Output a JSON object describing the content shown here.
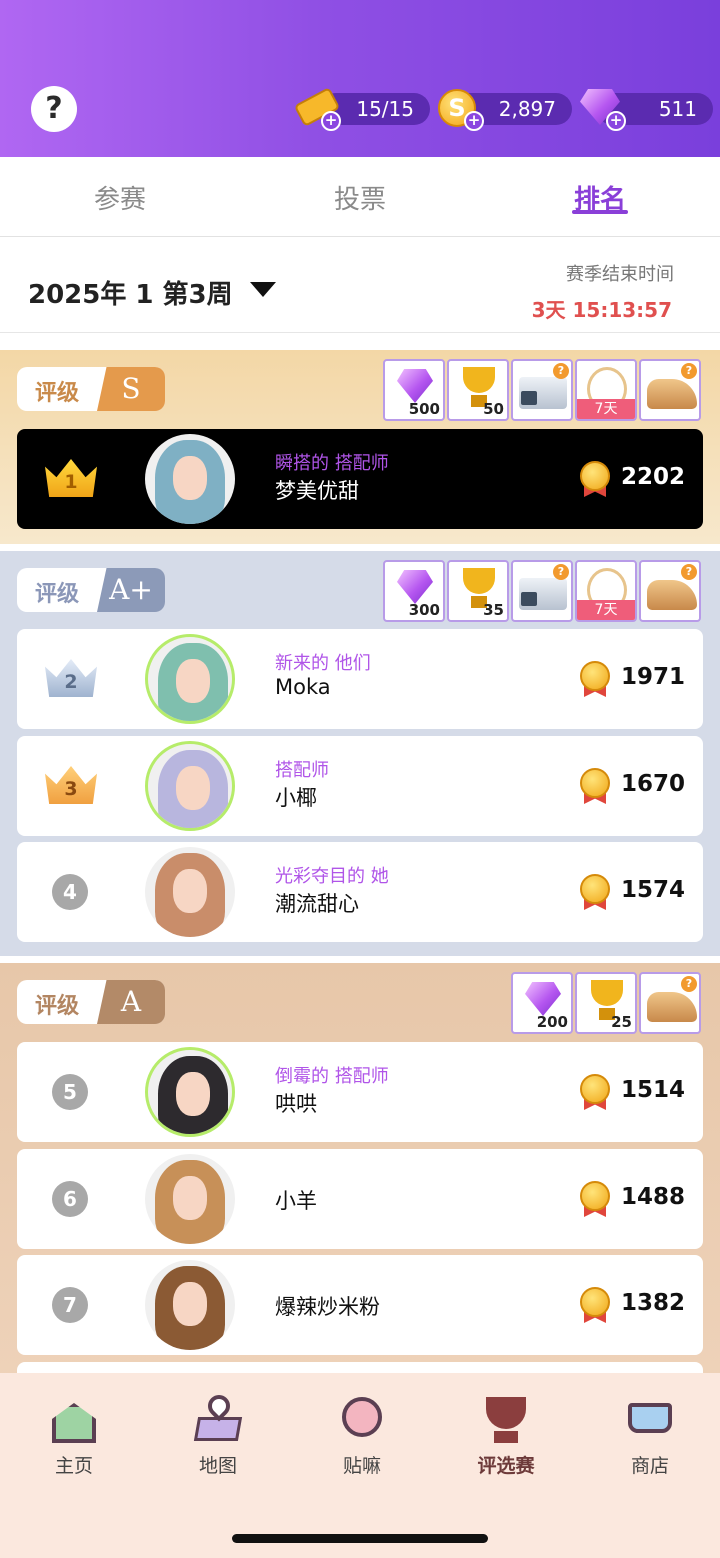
{
  "header": {
    "help_label": "?",
    "tickets": "15/15",
    "coins": "2,897",
    "gems": "511",
    "coin_symbol": "S",
    "plus": "+"
  },
  "tabs": [
    {
      "label": "参赛",
      "active": false
    },
    {
      "label": "投票",
      "active": false
    },
    {
      "label": "排名",
      "active": true
    }
  ],
  "week": {
    "label": "2025年 1 第3周",
    "season_end_label": "赛季结束时间",
    "countdown": "3天 15:13:57"
  },
  "tiers": [
    {
      "grade_label": "评级",
      "grade": "S",
      "rewards": [
        {
          "icon": "gem-icon",
          "amount": "500"
        },
        {
          "icon": "trophy-icon",
          "amount": "50"
        },
        {
          "icon": "makeup-set-icon",
          "amount": ""
        },
        {
          "icon": "necklace-icon",
          "amount": "",
          "tag": "7天"
        },
        {
          "icon": "shoe-icon",
          "amount": ""
        }
      ],
      "players": [
        {
          "rank": "1",
          "title": "瞬搭的 搭配师",
          "name": "梦美优甜",
          "score": "2202"
        }
      ]
    },
    {
      "grade_label": "评级",
      "grade": "A+",
      "rewards": [
        {
          "icon": "gem-icon",
          "amount": "300"
        },
        {
          "icon": "trophy-icon",
          "amount": "35"
        },
        {
          "icon": "makeup-set-icon",
          "amount": ""
        },
        {
          "icon": "necklace-icon",
          "amount": "",
          "tag": "7天"
        },
        {
          "icon": "shoe-icon",
          "amount": ""
        }
      ],
      "players": [
        {
          "rank": "2",
          "title": "新来的 他们",
          "name": "Moka",
          "score": "1971"
        },
        {
          "rank": "3",
          "title": "搭配师",
          "name": "小椰",
          "score": "1670"
        },
        {
          "rank": "4",
          "title": "光彩夺目的 她",
          "name": "潮流甜心",
          "score": "1574"
        }
      ]
    },
    {
      "grade_label": "评级",
      "grade": "A",
      "rewards": [
        {
          "icon": "gem-icon",
          "amount": "200"
        },
        {
          "icon": "trophy-icon",
          "amount": "25"
        },
        {
          "icon": "shoe-icon",
          "amount": ""
        }
      ],
      "players": [
        {
          "rank": "5",
          "title": "倒霉的 搭配师",
          "name": "哄哄",
          "score": "1514"
        },
        {
          "rank": "6",
          "title": "",
          "name": "小羊",
          "score": "1488"
        },
        {
          "rank": "7",
          "title": "",
          "name": "爆辣炒米粉",
          "score": "1382"
        }
      ]
    }
  ],
  "reward_badge": "?",
  "bottom_nav": [
    {
      "label": "主页",
      "icon": "home-icon",
      "active": false
    },
    {
      "label": "地图",
      "icon": "map-icon",
      "active": false
    },
    {
      "label": "贴嘛",
      "icon": "sticker-icon",
      "active": false
    },
    {
      "label": "评选赛",
      "icon": "trophy-icon",
      "active": true
    },
    {
      "label": "商店",
      "icon": "cart-icon",
      "active": false
    }
  ],
  "colors": {
    "header_purple": "#8f4fe4",
    "accent_purple": "#8a3fd8",
    "countdown_red": "#e0504f",
    "title_purple": "#b055e8"
  }
}
